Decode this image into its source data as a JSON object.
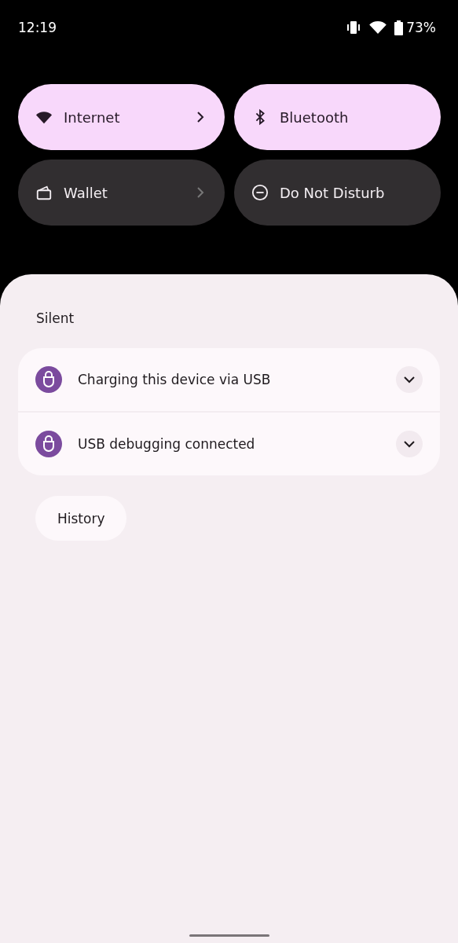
{
  "status_bar": {
    "time": "12:19",
    "battery": "73%"
  },
  "tiles": [
    {
      "label": "Internet",
      "kind": "wifi",
      "on": true,
      "arrow": true
    },
    {
      "label": "Bluetooth",
      "kind": "bluetooth",
      "on": true,
      "arrow": false
    },
    {
      "label": "Wallet",
      "kind": "wallet",
      "on": false,
      "arrow": true
    },
    {
      "label": "Do Not Disturb",
      "kind": "dnd",
      "on": false,
      "arrow": false
    }
  ],
  "section": "Silent",
  "notifications": [
    {
      "title": "Charging this device via USB",
      "expanded": false
    },
    {
      "title": "USB debugging connected",
      "expanded": false
    }
  ],
  "history_button": "History"
}
